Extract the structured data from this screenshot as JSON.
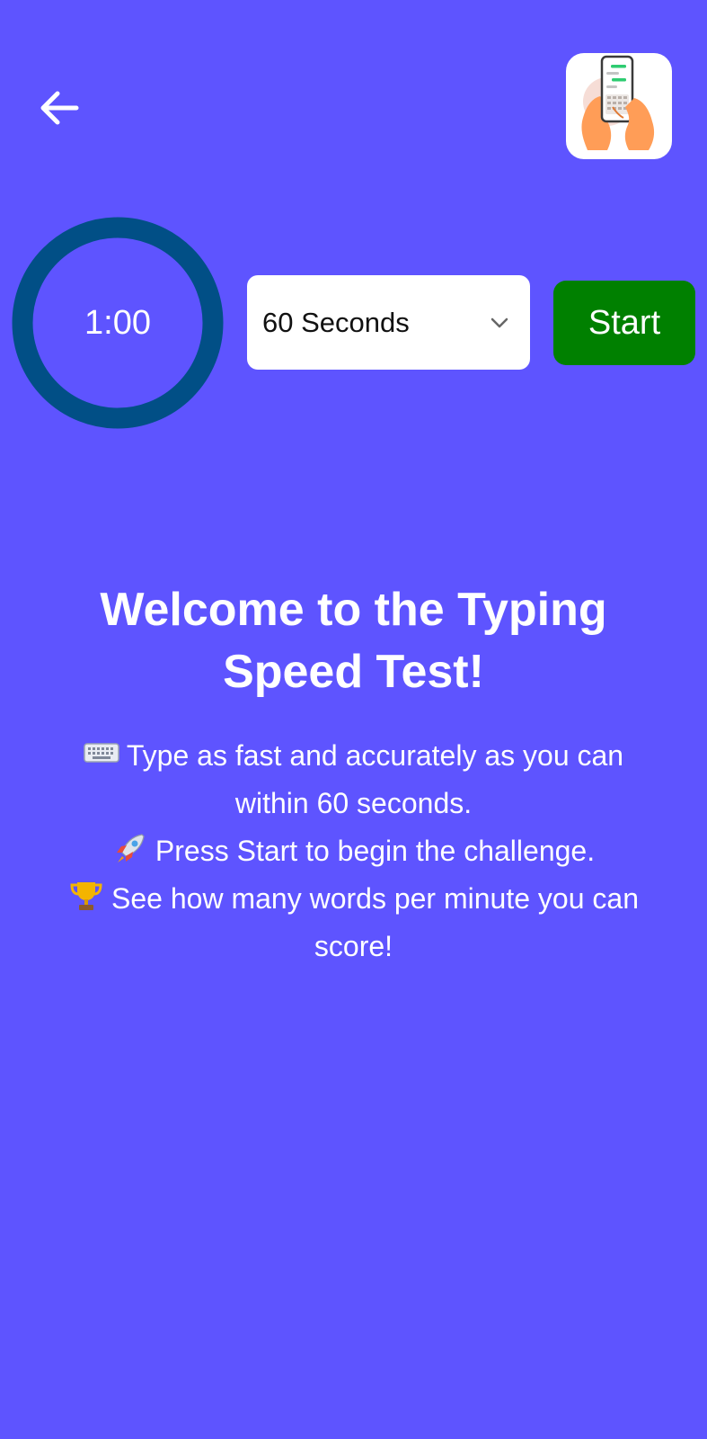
{
  "header": {
    "back_icon": "arrow-left-icon",
    "app_icon": "hands-typing-on-phone-icon"
  },
  "timer": {
    "display": "1:00",
    "ring_color": "#014f86"
  },
  "duration_select": {
    "selected": "60 Seconds",
    "icon": "chevron-down-icon"
  },
  "start_button": {
    "label": "Start",
    "color": "#008000"
  },
  "welcome": {
    "title_line1": "Welcome to the Typing",
    "title_line2": "Speed Test!",
    "instructions": {
      "line1": "Type as fast and accurately as you can",
      "line2": "within 60 seconds.",
      "line3": "Press Start to begin the challenge.",
      "line4": "See how many words per minute you can",
      "line5": "score!"
    },
    "emoji_icons": [
      "keyboard-icon",
      "rocket-icon",
      "trophy-icon"
    ]
  },
  "colors": {
    "background": "#5e54ff",
    "text": "#ffffff"
  }
}
